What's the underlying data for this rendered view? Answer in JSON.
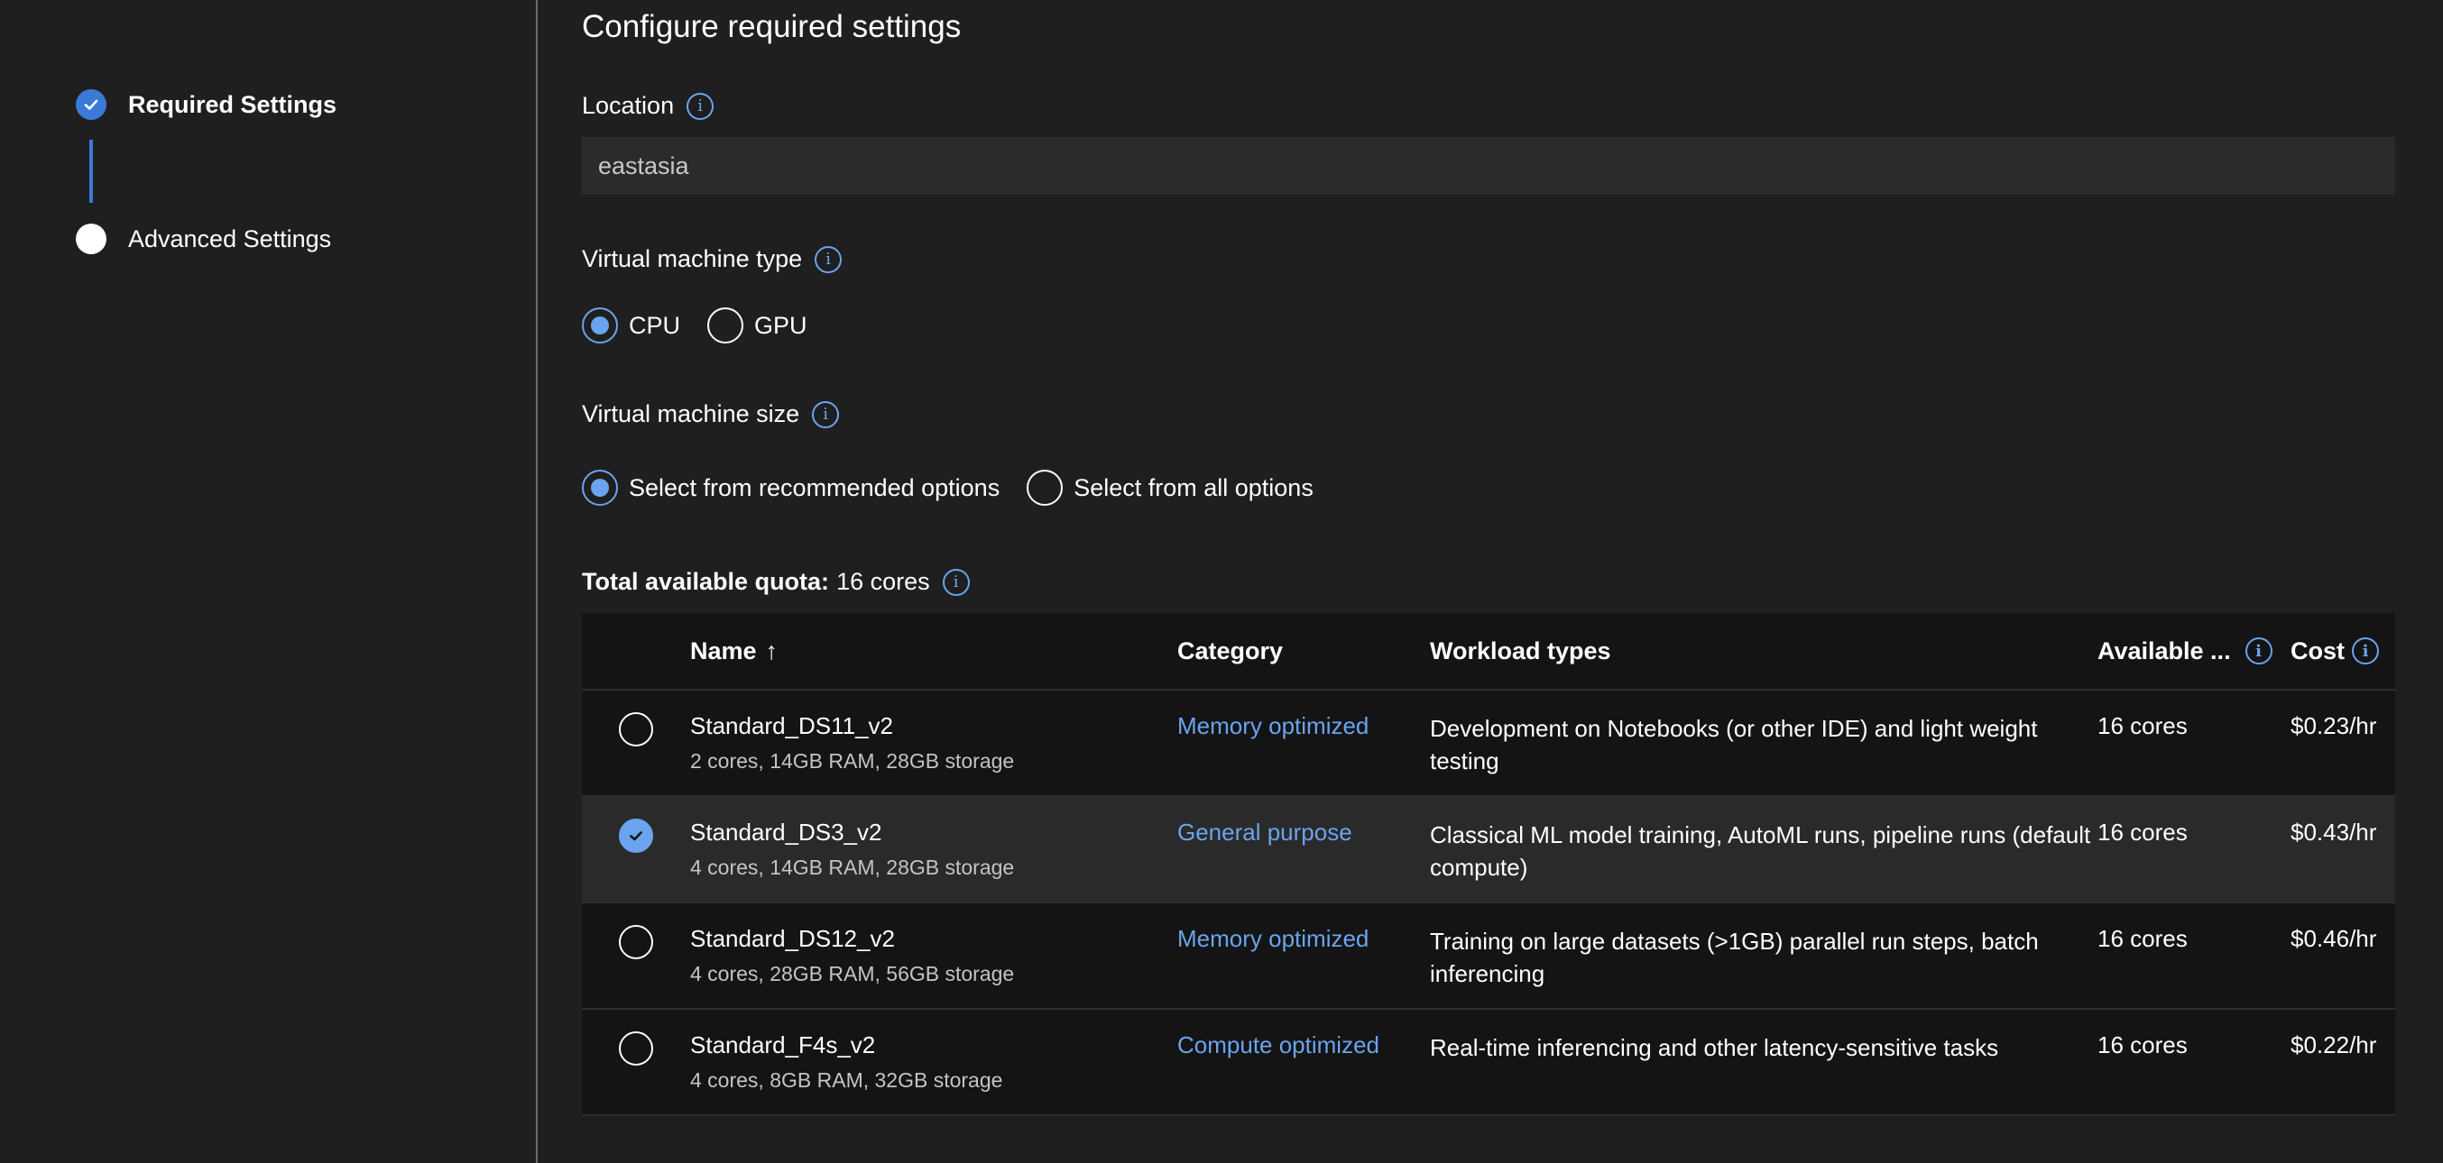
{
  "sidebar": {
    "steps": [
      {
        "label": "Required Settings",
        "state": "done"
      },
      {
        "label": "Advanced Settings",
        "state": "todo"
      }
    ]
  },
  "main": {
    "title": "Configure required settings",
    "location": {
      "label": "Location",
      "value": "eastasia"
    },
    "vm_type": {
      "label": "Virtual machine type",
      "options": [
        {
          "label": "CPU",
          "selected": true
        },
        {
          "label": "GPU",
          "selected": false
        }
      ]
    },
    "vm_size": {
      "label": "Virtual machine size",
      "options": [
        {
          "label": "Select from recommended options",
          "selected": true
        },
        {
          "label": "Select from all options",
          "selected": false
        }
      ]
    },
    "quota": {
      "label": "Total available quota:",
      "value": "16 cores"
    },
    "table": {
      "headers": {
        "name": "Name",
        "sort_arrow": "↑",
        "category": "Category",
        "workload": "Workload types",
        "available": "Available ...",
        "cost": "Cost"
      },
      "rows": [
        {
          "name": "Standard_DS11_v2",
          "spec": "2 cores, 14GB RAM, 28GB storage",
          "category": "Memory optimized",
          "workload": "Development on Notebooks (or other IDE) and light weight testing",
          "available": "16 cores",
          "cost": "$0.23/hr",
          "selected": false
        },
        {
          "name": "Standard_DS3_v2",
          "spec": "4 cores, 14GB RAM, 28GB storage",
          "category": "General purpose",
          "workload": "Classical ML model training, AutoML runs, pipeline runs (default compute)",
          "available": "16 cores",
          "cost": "$0.43/hr",
          "selected": true
        },
        {
          "name": "Standard_DS12_v2",
          "spec": "4 cores, 28GB RAM, 56GB storage",
          "category": "Memory optimized",
          "workload": "Training on large datasets (>1GB) parallel run steps, batch inferencing",
          "available": "16 cores",
          "cost": "$0.46/hr",
          "selected": false
        },
        {
          "name": "Standard_F4s_v2",
          "spec": "4 cores, 8GB RAM, 32GB storage",
          "category": "Compute optimized",
          "workload": "Real-time inferencing and other latency-sensitive tasks",
          "available": "16 cores",
          "cost": "$0.22/hr",
          "selected": false
        }
      ]
    }
  },
  "icons": {
    "info": "i",
    "check": "check-icon"
  },
  "colors": {
    "accent": "#6aa4ee",
    "step_done": "#3a7ad6",
    "background": "#1f1f1f",
    "table_background": "#141414",
    "selected_row": "#2a2a2a"
  }
}
